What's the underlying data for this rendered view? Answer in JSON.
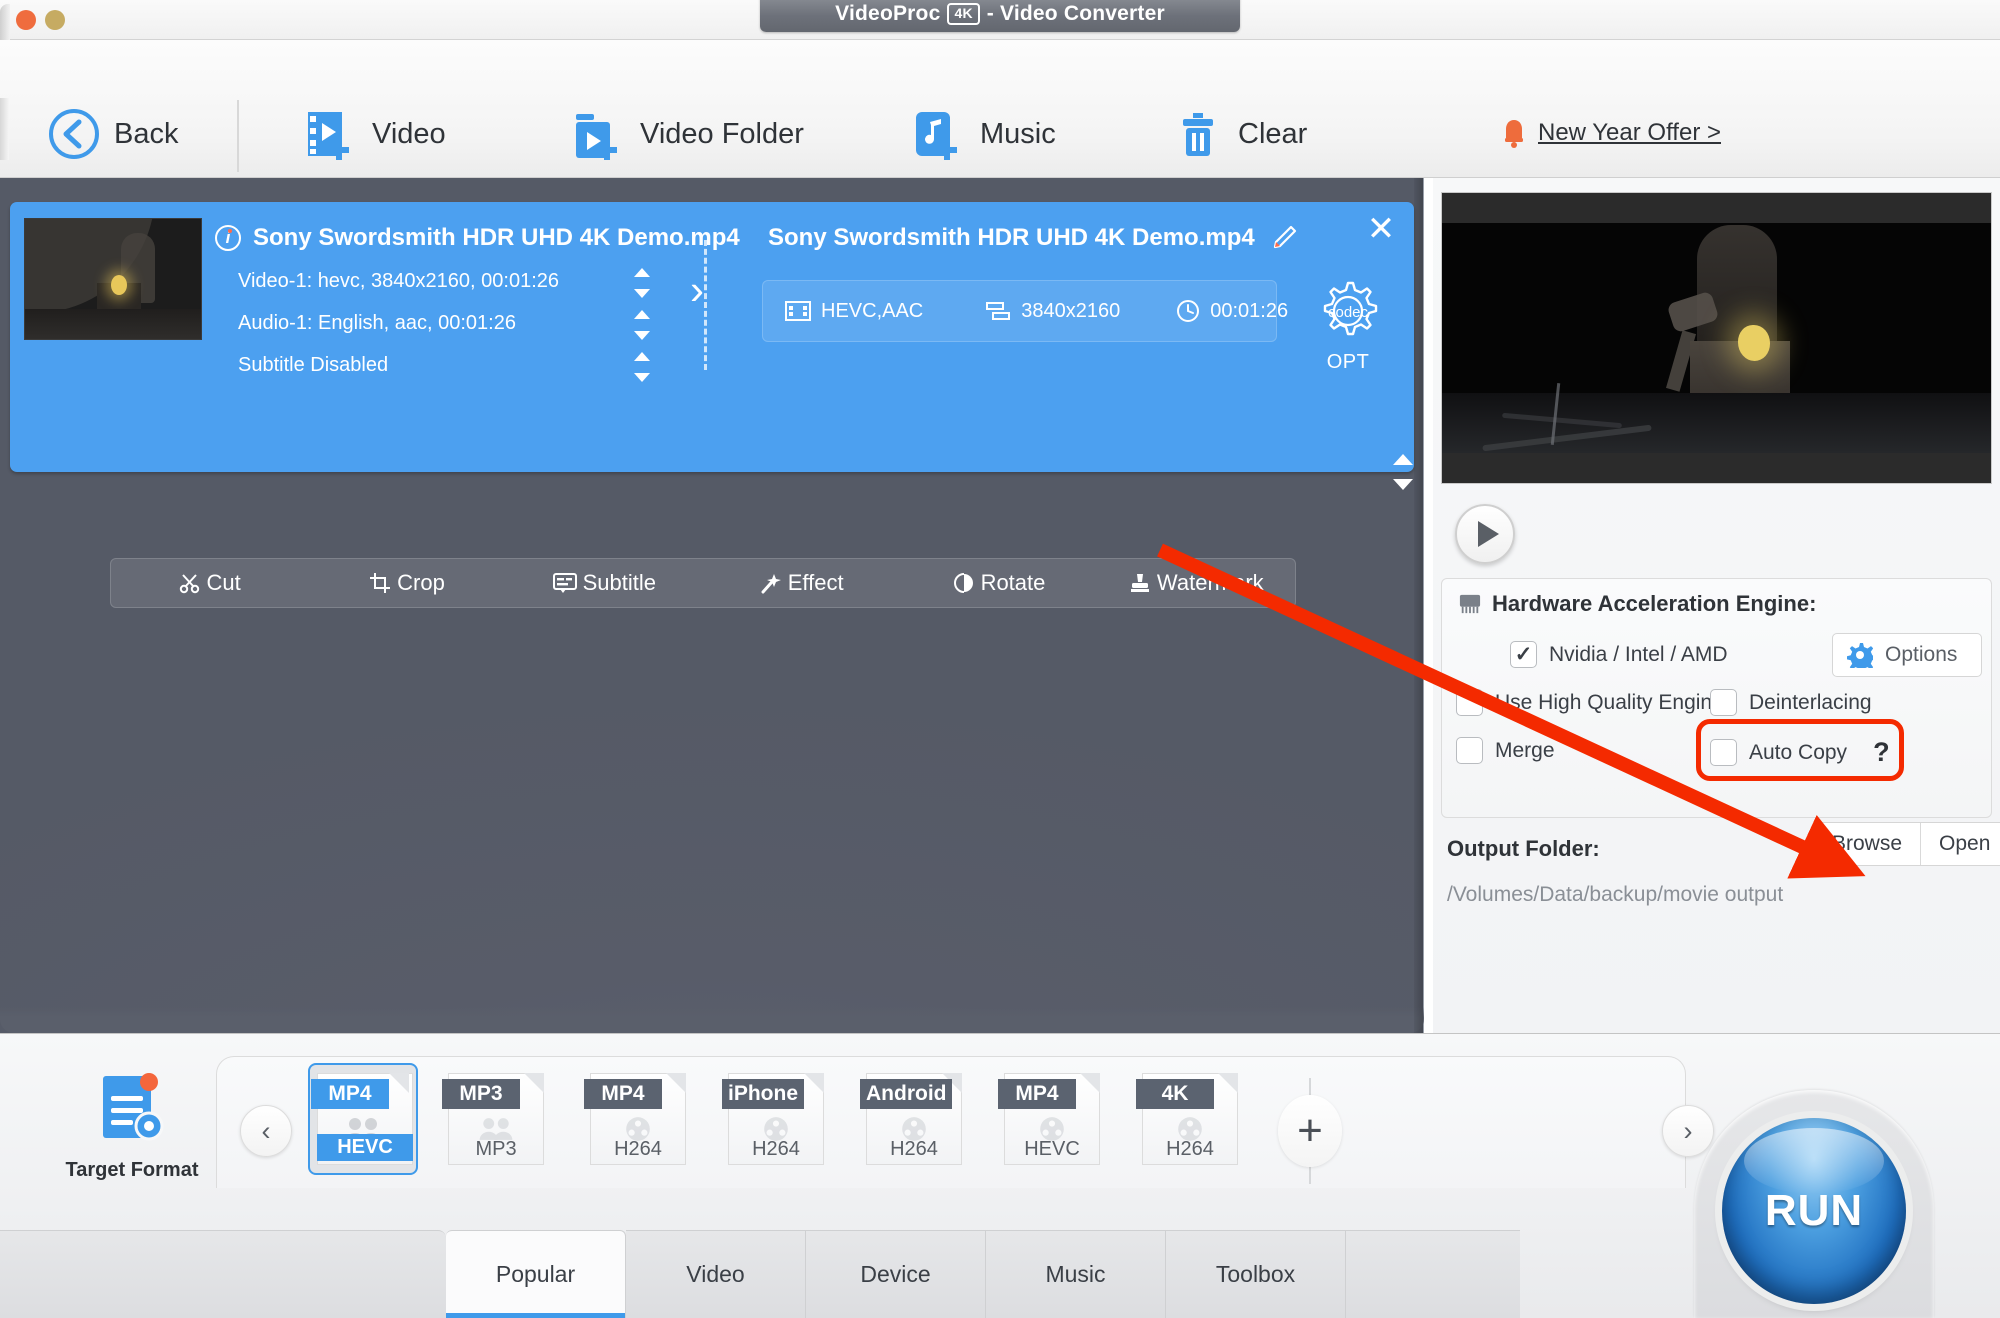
{
  "window": {
    "title": "VideoProc - Video Converter",
    "title_main": "VideoProc",
    "title_badge": "4K",
    "title_suffix": "- Video Converter",
    "traffic_close": "close-button",
    "traffic_minimize": "minimize-button"
  },
  "toolbar": {
    "items": [
      {
        "label": "Back",
        "icon": "back-arrow-icon"
      },
      {
        "label": "Video",
        "icon": "add-video-icon"
      },
      {
        "label": "Video Folder",
        "icon": "add-video-folder-icon"
      },
      {
        "label": "Music",
        "icon": "add-music-icon"
      },
      {
        "label": "Clear",
        "icon": "trash-icon"
      }
    ],
    "promo": {
      "label": "New Year Offer >",
      "icon": "bell-icon"
    }
  },
  "file_card": {
    "source_name": "Sony Swordsmith HDR UHD 4K Demo.mp4",
    "video_stream": "Video-1: hevc, 3840x2160, 00:01:26",
    "audio_stream": "Audio-1: English, aac, 00:01:26",
    "subtitle_stream": "Subtitle Disabled",
    "output_name": "Sony Swordsmith HDR UHD 4K Demo.mp4",
    "edit_icon": "pencil-icon",
    "info_icon": "info-icon",
    "close_icon": "close-icon",
    "meta": [
      {
        "label": "HEVC,AAC",
        "icon": "film-strip-icon"
      },
      {
        "label": "3840x2160",
        "icon": "resolution-icon"
      },
      {
        "label": "00:01:26",
        "icon": "clock-icon"
      }
    ],
    "opt": {
      "gear_text": "codec",
      "label": "OPT"
    }
  },
  "edit_bar": {
    "items": [
      {
        "label": "Cut",
        "icon": "scissors-icon"
      },
      {
        "label": "Crop",
        "icon": "crop-icon"
      },
      {
        "label": "Subtitle",
        "icon": "subtitle-icon"
      },
      {
        "label": "Effect",
        "icon": "magic-wand-icon"
      },
      {
        "label": "Rotate",
        "icon": "rotate-icon"
      },
      {
        "label": "Watermark",
        "icon": "stamp-icon"
      }
    ]
  },
  "preview": {
    "play_icon": "play-icon"
  },
  "settings": {
    "hw_title": "Hardware Acceleration Engine:",
    "hw_icon": "cpu-chip-icon",
    "nvidia_label": "Nvidia / Intel / AMD",
    "nvidia_checked": true,
    "options_label": "Options",
    "options_icon": "gear-icon",
    "high_quality_label": "Use High Quality Engine",
    "high_quality_checked": false,
    "deinterlacing_label": "Deinterlacing",
    "deinterlacing_checked": false,
    "merge_label": "Merge",
    "merge_checked": false,
    "auto_copy_label": "Auto Copy",
    "auto_copy_checked": false,
    "help_label": "?",
    "output_folder_label": "Output Folder:",
    "output_folder_path": "/Volumes/Data/backup/movie output",
    "browse_label": "Browse",
    "open_label": "Open",
    "highlight_color": "#f42a00"
  },
  "bottom": {
    "target_format_label": "Target Format",
    "target_format_icon": "document-settings-icon",
    "prev_arrow": "chevron-left-icon",
    "next_arrow": "chevron-right-icon",
    "add_format_icon": "plus-icon",
    "formats": [
      {
        "top": "MP4",
        "bottom": "HEVC",
        "selected": true,
        "glyph": "people-icon"
      },
      {
        "top": "MP3",
        "bottom": "MP3",
        "selected": false,
        "glyph": "people-icon"
      },
      {
        "top": "MP4",
        "bottom": "H264",
        "selected": false,
        "glyph": "film-reel-icon"
      },
      {
        "top": "iPhone",
        "bottom": "H264",
        "selected": false,
        "glyph": "film-reel-icon"
      },
      {
        "top": "Android",
        "bottom": "H264",
        "selected": false,
        "glyph": "film-reel-icon"
      },
      {
        "top": "MP4",
        "bottom": "HEVC",
        "selected": false,
        "glyph": "film-reel-icon"
      },
      {
        "top": "4K",
        "bottom": "H264",
        "selected": false,
        "glyph": "film-reel-icon"
      }
    ],
    "tabs": [
      {
        "label": "Popular",
        "active": true
      },
      {
        "label": "Video",
        "active": false
      },
      {
        "label": "Device",
        "active": false
      },
      {
        "label": "Music",
        "active": false
      },
      {
        "label": "Toolbox",
        "active": false
      }
    ],
    "run_label": "RUN"
  },
  "colors": {
    "accent_blue": "#3f9aea",
    "card_blue": "#4ca0f0",
    "annotation_red": "#f42a00",
    "promo_orange": "#ee6c3c"
  }
}
